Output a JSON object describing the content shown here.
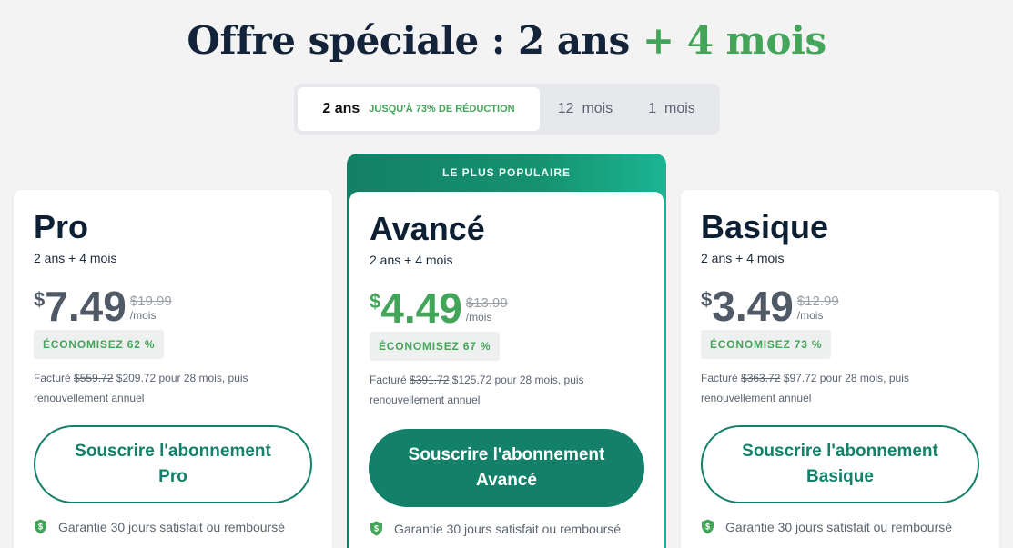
{
  "headline": {
    "main": "Offre spéciale : 2 ans",
    "accent": "+ 4 mois"
  },
  "tabs": [
    {
      "label": "2 ans",
      "badge": "JUSQU'À 73% DE RÉDUCTION"
    },
    {
      "label": "12  mois"
    },
    {
      "label": "1  mois"
    }
  ],
  "featured_banner": "LE PLUS POPULAIRE",
  "plans": {
    "pro": {
      "name": "Pro",
      "term": "2 ans + 4 mois",
      "currency": "$",
      "price": "7.49",
      "old_price": "$19.99",
      "per": "/mois",
      "save": "ÉCONOMISEZ 62 %",
      "billing_prefix": "Facturé",
      "billing_old": "$559.72",
      "billing_rest": "$209.72 pour 28 mois, puis renouvellement annuel",
      "cta_line1": "Souscrire l'abonnement",
      "cta_line2": "Pro",
      "guarantee": "Garantie 30 jours satisfait ou remboursé"
    },
    "avance": {
      "name": "Avancé",
      "term": "2 ans + 4 mois",
      "currency": "$",
      "price": "4.49",
      "old_price": "$13.99",
      "per": "/mois",
      "save": "ÉCONOMISEZ 67 %",
      "billing_prefix": "Facturé",
      "billing_old": "$391.72",
      "billing_rest": "$125.72 pour 28 mois, puis renouvellement annuel",
      "cta_line1": "Souscrire l'abonnement",
      "cta_line2": "Avancé",
      "guarantee": "Garantie 30 jours satisfait ou remboursé"
    },
    "basique": {
      "name": "Basique",
      "term": "2 ans + 4 mois",
      "currency": "$",
      "price": "3.49",
      "old_price": "$12.99",
      "per": "/mois",
      "save": "ÉCONOMISEZ 73 %",
      "billing_prefix": "Facturé",
      "billing_old": "$363.72",
      "billing_rest": "$97.72 pour 28 mois, puis renouvellement annuel",
      "cta_line1": "Souscrire l'abonnement",
      "cta_line2": "Basique",
      "guarantee": "Garantie 30 jours satisfait ou remboursé"
    }
  },
  "colors": {
    "accent_green": "#43a55a",
    "brand_teal": "#13806a",
    "heading_navy": "#13243a"
  },
  "icons": {
    "guarantee": "shield-dollar-icon"
  }
}
